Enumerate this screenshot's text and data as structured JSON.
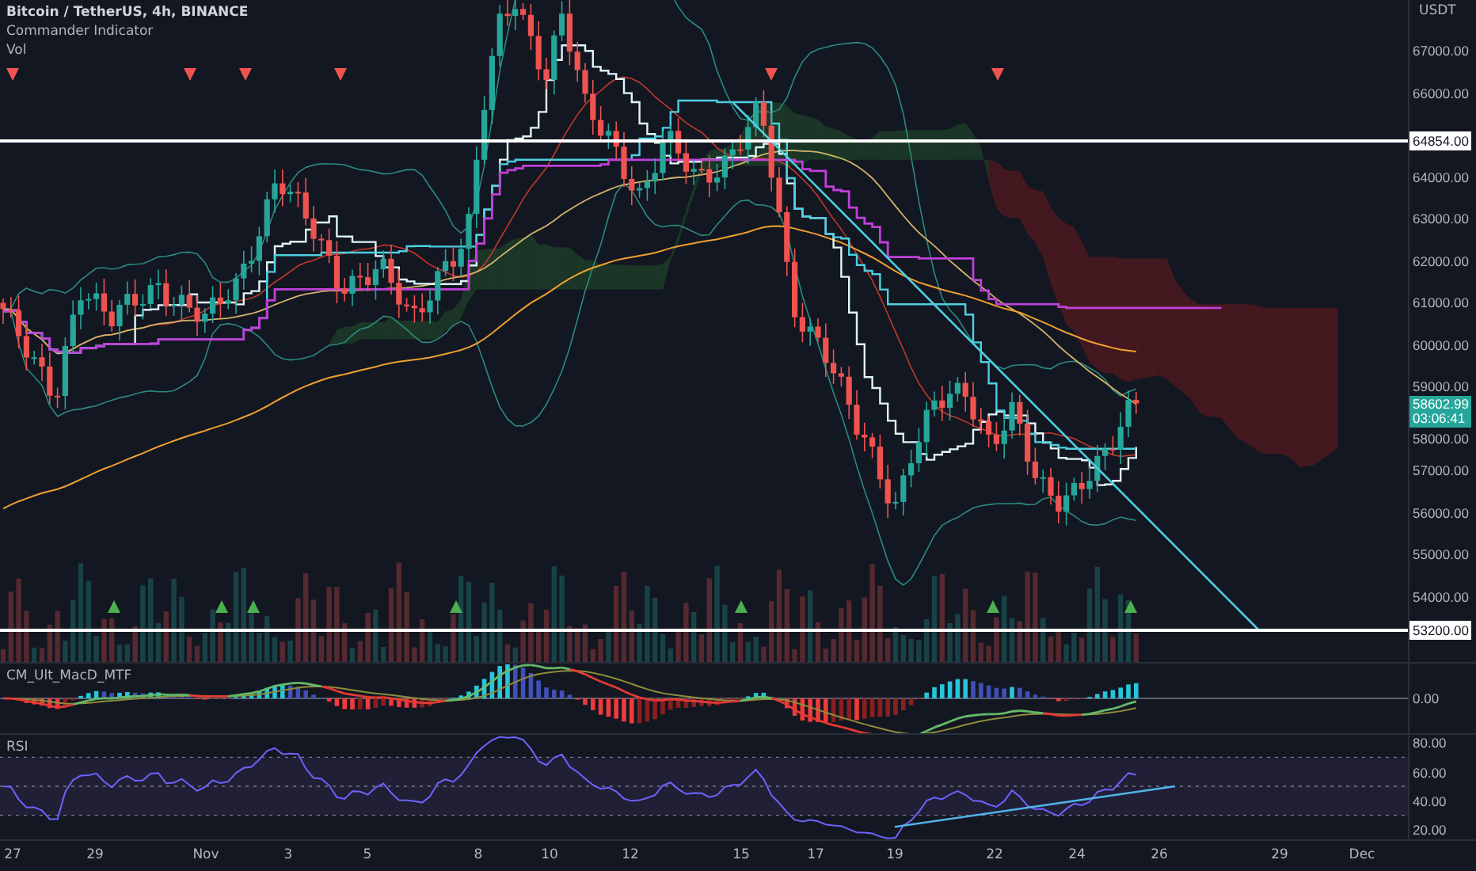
{
  "legend": {
    "symbol": "Bitcoin / TetherUS, 4h, BINANCE",
    "indicators": [
      "Commander Indicator",
      "Vol"
    ]
  },
  "price_axis": {
    "currency": "USDT",
    "ticks": [
      "67000.00",
      "66000.00",
      "64000.00",
      "63000.00",
      "62000.00",
      "61000.00",
      "60000.00",
      "59000.00",
      "58000.00",
      "57000.00",
      "56000.00",
      "55000.00",
      "54000.00"
    ]
  },
  "price_levels": [
    {
      "label": "64854.00"
    },
    {
      "label": "53200.00"
    }
  ],
  "last_price": {
    "price": "58602.99",
    "countdown": "03:06:41"
  },
  "macd_pane": {
    "title": "CM_Ult_MacD_MTF",
    "ticks": [
      "0.00"
    ]
  },
  "rsi_pane": {
    "title": "RSI",
    "ticks": [
      "80.00",
      "60.00",
      "40.00",
      "20.00"
    ]
  },
  "time_axis": {
    "ticks": [
      "27",
      "29",
      "Nov",
      "3",
      "5",
      "8",
      "10",
      "12",
      "15",
      "17",
      "19",
      "22",
      "24",
      "26",
      "29",
      "Dec"
    ]
  }
}
